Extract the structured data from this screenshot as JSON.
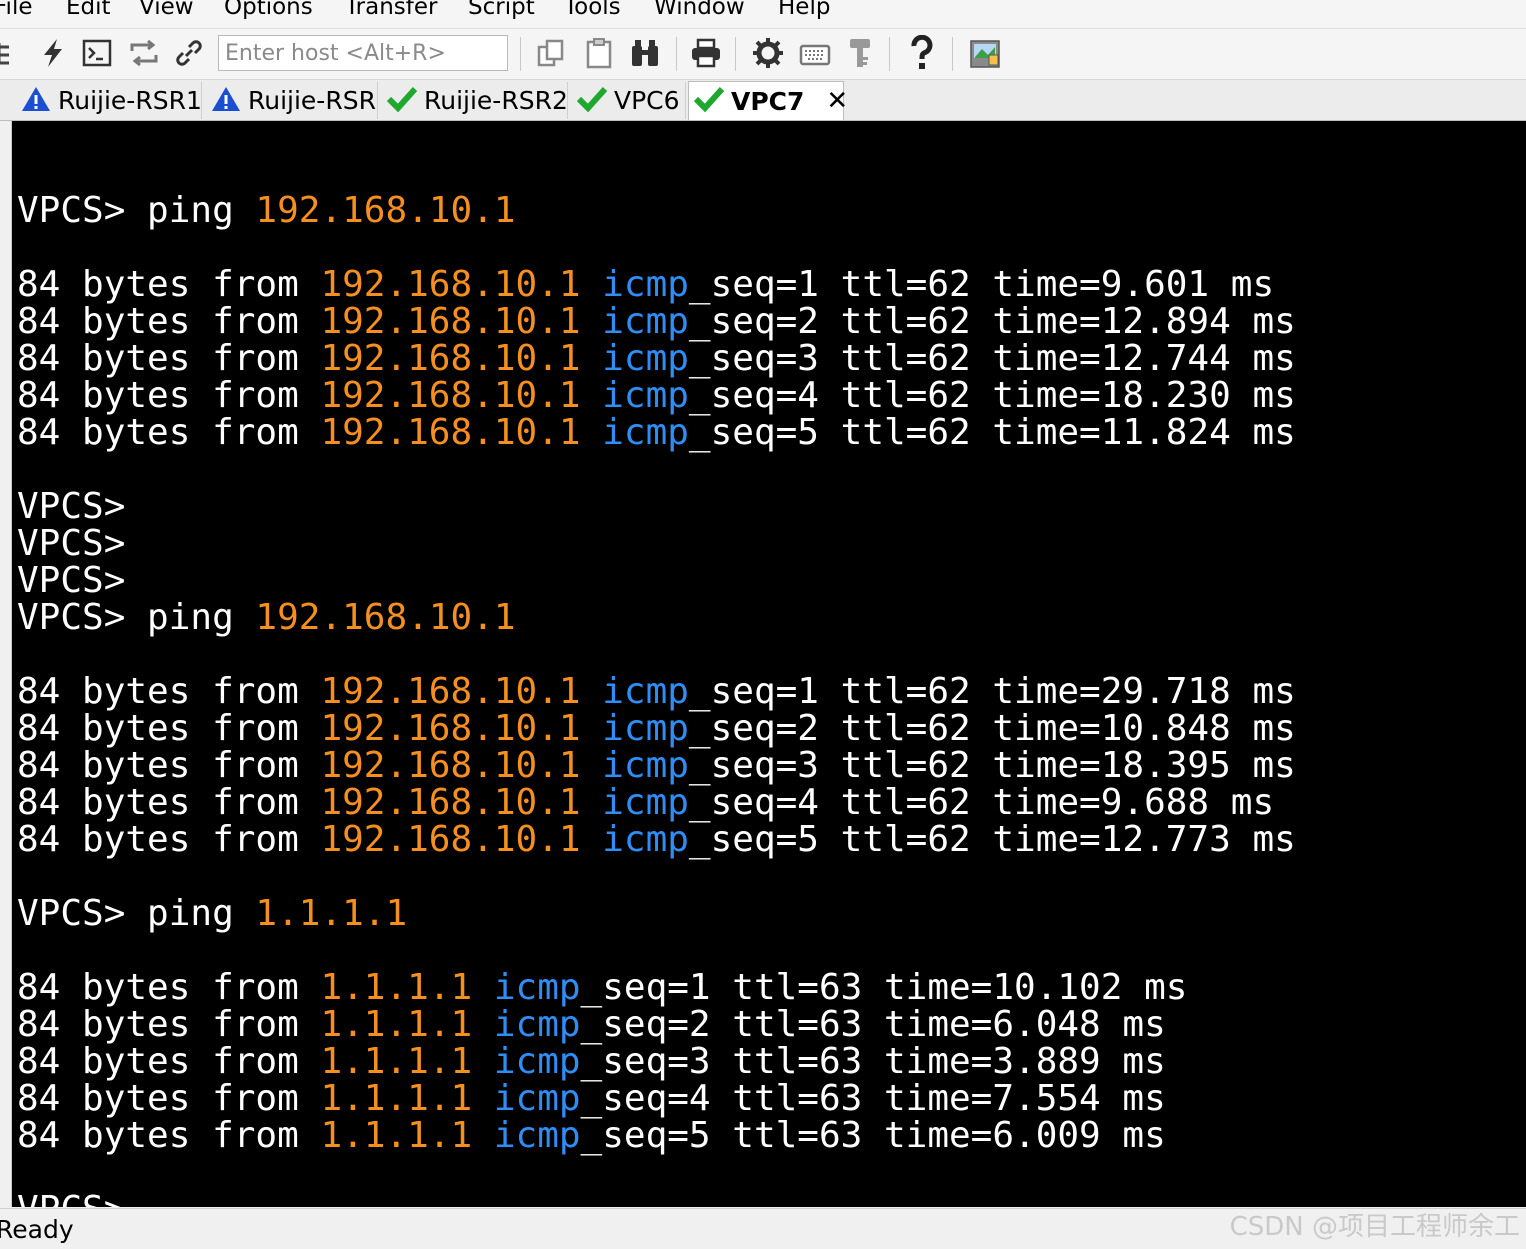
{
  "menu": [
    "File",
    "Edit",
    "View",
    "Options",
    "Transfer",
    "Script",
    "Tools",
    "Window",
    "Help"
  ],
  "toolbar": {
    "icons": [
      "tree-icon",
      "lightning-icon",
      "terminal-icon",
      "reconnect-icon",
      "link-icon",
      "copy-icon",
      "clipboard-icon",
      "binoculars-icon",
      "printer-icon",
      "gear-icon",
      "keyboard-icon",
      "key-icon",
      "help-icon",
      "image-icon"
    ],
    "host_placeholder": "Enter host <Alt+R>"
  },
  "tabs": [
    {
      "label": "Ruijie-RSR1",
      "status": "warning"
    },
    {
      "label": "Ruijie-RSR",
      "status": "warning"
    },
    {
      "label": "Ruijie-RSR2",
      "status": "ok"
    },
    {
      "label": "VPC6",
      "status": "ok"
    },
    {
      "label": "VPC7",
      "status": "ok",
      "active": true
    }
  ],
  "colors": {
    "ip": "#f58f1f",
    "icmp": "#2f8ef5",
    "text": "#ffffff",
    "background": "#000000",
    "warning": "#1a4fd1",
    "ok": "#1fa82f"
  },
  "terminal": {
    "lines": [
      [
        {
          "t": ""
        }
      ],
      [
        {
          "t": "VPCS> ping "
        },
        {
          "t": "192.168.10.1",
          "c": "ip"
        }
      ],
      [
        {
          "t": ""
        }
      ],
      [
        {
          "t": "84 bytes from "
        },
        {
          "t": "192.168.10.1",
          "c": "ip"
        },
        {
          "t": " "
        },
        {
          "t": "icmp",
          "c": "icmp"
        },
        {
          "t": "_seq=1 ttl=62 time=9.601 ms"
        }
      ],
      [
        {
          "t": "84 bytes from "
        },
        {
          "t": "192.168.10.1",
          "c": "ip"
        },
        {
          "t": " "
        },
        {
          "t": "icmp",
          "c": "icmp"
        },
        {
          "t": "_seq=2 ttl=62 time=12.894 ms"
        }
      ],
      [
        {
          "t": "84 bytes from "
        },
        {
          "t": "192.168.10.1",
          "c": "ip"
        },
        {
          "t": " "
        },
        {
          "t": "icmp",
          "c": "icmp"
        },
        {
          "t": "_seq=3 ttl=62 time=12.744 ms"
        }
      ],
      [
        {
          "t": "84 bytes from "
        },
        {
          "t": "192.168.10.1",
          "c": "ip"
        },
        {
          "t": " "
        },
        {
          "t": "icmp",
          "c": "icmp"
        },
        {
          "t": "_seq=4 ttl=62 time=18.230 ms"
        }
      ],
      [
        {
          "t": "84 bytes from "
        },
        {
          "t": "192.168.10.1",
          "c": "ip"
        },
        {
          "t": " "
        },
        {
          "t": "icmp",
          "c": "icmp"
        },
        {
          "t": "_seq=5 ttl=62 time=11.824 ms"
        }
      ],
      [
        {
          "t": ""
        }
      ],
      [
        {
          "t": "VPCS>"
        }
      ],
      [
        {
          "t": "VPCS>"
        }
      ],
      [
        {
          "t": "VPCS>"
        }
      ],
      [
        {
          "t": "VPCS> ping "
        },
        {
          "t": "192.168.10.1",
          "c": "ip"
        }
      ],
      [
        {
          "t": ""
        }
      ],
      [
        {
          "t": "84 bytes from "
        },
        {
          "t": "192.168.10.1",
          "c": "ip"
        },
        {
          "t": " "
        },
        {
          "t": "icmp",
          "c": "icmp"
        },
        {
          "t": "_seq=1 ttl=62 time=29.718 ms"
        }
      ],
      [
        {
          "t": "84 bytes from "
        },
        {
          "t": "192.168.10.1",
          "c": "ip"
        },
        {
          "t": " "
        },
        {
          "t": "icmp",
          "c": "icmp"
        },
        {
          "t": "_seq=2 ttl=62 time=10.848 ms"
        }
      ],
      [
        {
          "t": "84 bytes from "
        },
        {
          "t": "192.168.10.1",
          "c": "ip"
        },
        {
          "t": " "
        },
        {
          "t": "icmp",
          "c": "icmp"
        },
        {
          "t": "_seq=3 ttl=62 time=18.395 ms"
        }
      ],
      [
        {
          "t": "84 bytes from "
        },
        {
          "t": "192.168.10.1",
          "c": "ip"
        },
        {
          "t": " "
        },
        {
          "t": "icmp",
          "c": "icmp"
        },
        {
          "t": "_seq=4 ttl=62 time=9.688 ms"
        }
      ],
      [
        {
          "t": "84 bytes from "
        },
        {
          "t": "192.168.10.1",
          "c": "ip"
        },
        {
          "t": " "
        },
        {
          "t": "icmp",
          "c": "icmp"
        },
        {
          "t": "_seq=5 ttl=62 time=12.773 ms"
        }
      ],
      [
        {
          "t": ""
        }
      ],
      [
        {
          "t": "VPCS> ping "
        },
        {
          "t": "1.1.1.1",
          "c": "ip"
        }
      ],
      [
        {
          "t": ""
        }
      ],
      [
        {
          "t": "84 bytes from "
        },
        {
          "t": "1.1.1.1",
          "c": "ip"
        },
        {
          "t": " "
        },
        {
          "t": "icmp",
          "c": "icmp"
        },
        {
          "t": "_seq=1 ttl=63 time=10.102 ms"
        }
      ],
      [
        {
          "t": "84 bytes from "
        },
        {
          "t": "1.1.1.1",
          "c": "ip"
        },
        {
          "t": " "
        },
        {
          "t": "icmp",
          "c": "icmp"
        },
        {
          "t": "_seq=2 ttl=63 time=6.048 ms"
        }
      ],
      [
        {
          "t": "84 bytes from "
        },
        {
          "t": "1.1.1.1",
          "c": "ip"
        },
        {
          "t": " "
        },
        {
          "t": "icmp",
          "c": "icmp"
        },
        {
          "t": "_seq=3 ttl=63 time=3.889 ms"
        }
      ],
      [
        {
          "t": "84 bytes from "
        },
        {
          "t": "1.1.1.1",
          "c": "ip"
        },
        {
          "t": " "
        },
        {
          "t": "icmp",
          "c": "icmp"
        },
        {
          "t": "_seq=4 ttl=63 time=7.554 ms"
        }
      ],
      [
        {
          "t": "84 bytes from "
        },
        {
          "t": "1.1.1.1",
          "c": "ip"
        },
        {
          "t": " "
        },
        {
          "t": "icmp",
          "c": "icmp"
        },
        {
          "t": "_seq=5 ttl=63 time=6.009 ms"
        }
      ],
      [
        {
          "t": ""
        }
      ],
      [
        {
          "t": "VPCS>"
        }
      ]
    ]
  },
  "status": {
    "text": "Ready"
  },
  "watermark": "CSDN @项目工程师余工"
}
